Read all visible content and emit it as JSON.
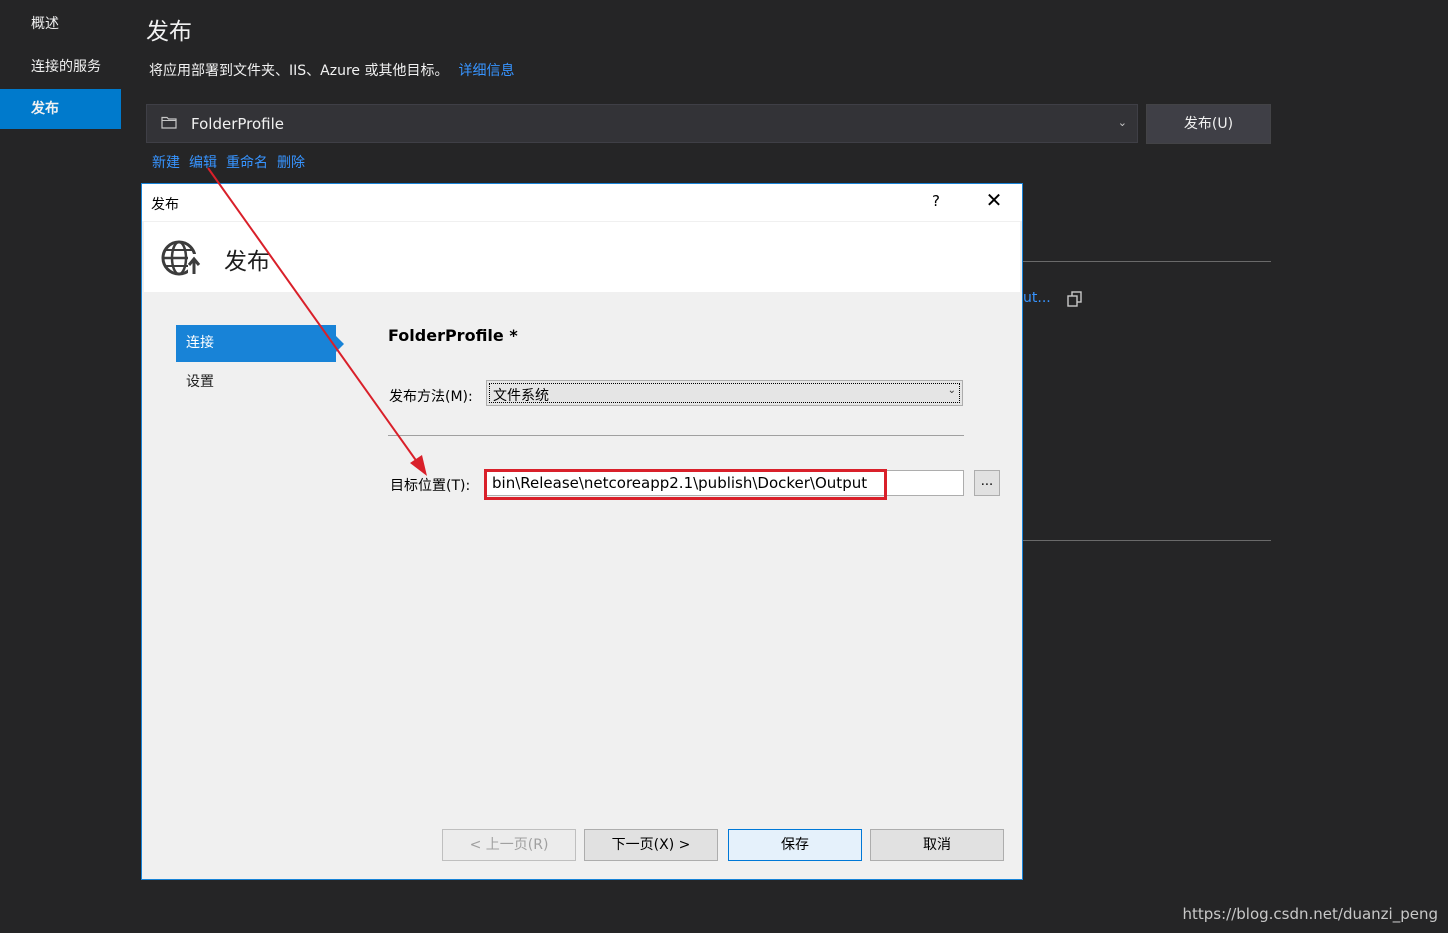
{
  "nav": {
    "items": [
      {
        "label": "概述",
        "active": false
      },
      {
        "label": "连接的服务",
        "active": false
      },
      {
        "label": "发布",
        "active": true
      }
    ]
  },
  "main": {
    "title": "发布",
    "description": "将应用部署到文件夹、IIS、Azure 或其他目标。",
    "details_link": "详细信息",
    "profile": {
      "name": "FolderProfile"
    },
    "publish_button": "发布(U)",
    "actions": [
      "新建",
      "编辑",
      "重命名",
      "删除"
    ],
    "truncated_text": "ut..."
  },
  "dialog": {
    "title": "发布",
    "help_label": "?",
    "close_label": "✕",
    "header_title": "发布",
    "side_items": [
      {
        "label": "连接",
        "active": true
      },
      {
        "label": "设置",
        "active": false
      }
    ],
    "profile_name": "FolderProfile *",
    "method_label": "发布方法(M):",
    "method_value": "文件系统",
    "target_label": "目标位置(T):",
    "target_value": "bin\\Release\\netcoreapp2.1\\publish\\Docker\\Output",
    "browse_label": "...",
    "buttons": {
      "prev": "< 上一页(R)",
      "next": "下一页(X) >",
      "save": "保存",
      "cancel": "取消"
    }
  },
  "colors": {
    "accent": "#007acc",
    "annotation": "#d9202a",
    "link": "#3794ff"
  },
  "watermark": "https://blog.csdn.net/duanzi_peng"
}
